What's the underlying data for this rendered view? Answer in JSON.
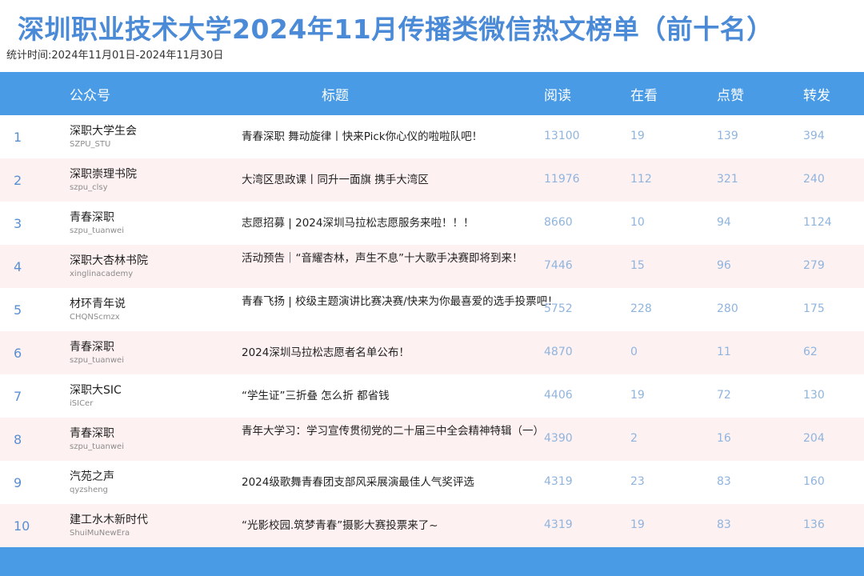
{
  "title": "深圳职业技术大学2024年11月传播类微信热文榜单（前十名）",
  "period": "统计时间:2024年11月01日-2024年11月30日",
  "colors": {
    "header": "#4a9be6",
    "title": "#4a8ad6",
    "alt_row": "#fdf1f1"
  },
  "columns": {
    "account": "公众号",
    "title": "标题",
    "reads": "阅读",
    "looking": "在看",
    "likes": "点赞",
    "shares": "转发"
  },
  "rows": [
    {
      "rank": "1",
      "account": "深职大学生会",
      "account_id": "SZPU_STU",
      "title": "青春深职 舞动旋律丨快来Pick你心仪的啦啦队吧！",
      "reads": "13100",
      "looking": "19",
      "likes": "139",
      "shares": "394"
    },
    {
      "rank": "2",
      "account": "深职崇理书院",
      "account_id": "szpu_clsy",
      "title": "大湾区思政课丨同升一面旗 携手大湾区",
      "reads": "11976",
      "looking": "112",
      "likes": "321",
      "shares": "240"
    },
    {
      "rank": "3",
      "account": "青春深职",
      "account_id": "szpu_tuanwei",
      "title": "志愿招募 | 2024深圳马拉松志愿服务来啦！！！",
      "reads": "8660",
      "looking": "10",
      "likes": "94",
      "shares": "1124"
    },
    {
      "rank": "4",
      "account": "深职大杏林书院",
      "account_id": "xinglinacademy",
      "title": "活动预告｜“音耀杏林，声生不息”十大歌手决赛即将到来！",
      "reads": "7446",
      "looking": "15",
      "likes": "96",
      "shares": "279"
    },
    {
      "rank": "5",
      "account": "材环青年说",
      "account_id": "CHQNScmzx",
      "title": "青春飞扬 | 校级主题演讲比赛决赛/快来为你最喜爱的选手投票吧！",
      "reads": "5752",
      "looking": "228",
      "likes": "280",
      "shares": "175"
    },
    {
      "rank": "6",
      "account": "青春深职",
      "account_id": "szpu_tuanwei",
      "title": "2024深圳马拉松志愿者名单公布！",
      "reads": "4870",
      "looking": "0",
      "likes": "11",
      "shares": "62"
    },
    {
      "rank": "7",
      "account": "深职大SIC",
      "account_id": "iSICer",
      "title": "“学生证”三折叠 怎么折 都省钱",
      "reads": "4406",
      "looking": "19",
      "likes": "72",
      "shares": "130"
    },
    {
      "rank": "8",
      "account": "青春深职",
      "account_id": "szpu_tuanwei",
      "title": "青年大学习：学习宣传贯彻党的二十届三中全会精神特辑（一）",
      "reads": "4390",
      "looking": "2",
      "likes": "16",
      "shares": "204"
    },
    {
      "rank": "9",
      "account": "汽苑之声",
      "account_id": "qyzsheng",
      "title": "2024级歌舞青春团支部风采展演最佳人气奖评选",
      "reads": "4319",
      "looking": "23",
      "likes": "83",
      "shares": "160"
    },
    {
      "rank": "10",
      "account": "建工水木新时代",
      "account_id": "ShuiMuNewEra",
      "title": "“光影校园.筑梦青春”摄影大赛投票来了~",
      "reads": "4319",
      "looking": "19",
      "likes": "83",
      "shares": "136"
    }
  ]
}
